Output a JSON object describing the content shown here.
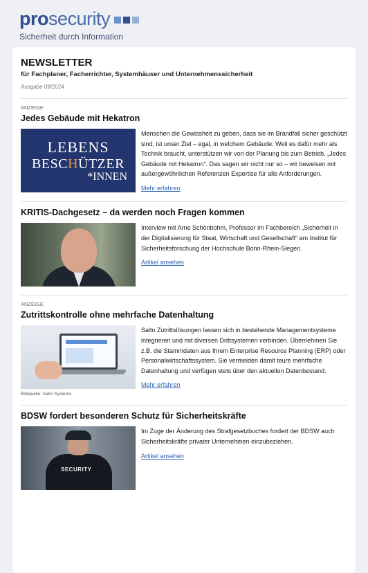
{
  "brand": {
    "logo_pro": "pro",
    "logo_security": "security",
    "tagline": "Sicherheit durch Information",
    "square_colors": [
      "#6e8fd0",
      "#2f4f8f",
      "#9ab0db"
    ]
  },
  "newsletter": {
    "title": "NEWSLETTER",
    "subtitle": "für Fachplaner, Facherrichter, Systemhäuser und Unternehmenssicherheit",
    "issue": "Ausgabe 09/2024"
  },
  "articles": [
    {
      "tag": "ANZEIGE",
      "title": "Jedes Gebäude mit Hekatron",
      "image_text": {
        "line1": "LEBENS",
        "line2a": "BESC",
        "line2b": "H",
        "line2c": "ÜTZER",
        "line3": "*INNEN"
      },
      "body": "Menschen die Gewissheit zu geben, dass sie im Brandfall sicher geschützt sind, ist unser Ziel – egal, in welchem Gebäude. Weil es dafür mehr als Technik braucht, unterstützen wir von der Planung bis zum Betrieb. „Jedes Gebäude mit Hekatron“. Das sagen wir nicht nur so – wir beweisen mit außergewöhnlichen Referenzen Expertise für alle Anforderungen.",
      "link": "Mehr erfahren"
    },
    {
      "tag": "",
      "title": "KRITIS-Dachgesetz – da werden noch Fragen kommen",
      "body": "Interview mit Arne Schönbohm, Professor im Fachbereich „Sicherheit in der Digitalisierung für Staat, Wirtschaft und Gesellschaft“ am Institut für Sicherheitsforschung der Hochschule Bonn-Rhein-Siegen.",
      "link": "Artikel ansehen"
    },
    {
      "tag": "ANZEIGE",
      "title": "Zutrittskontrolle ohne mehrfache Datenhaltung",
      "caption": "Bildquelle: Salto Systems",
      "body": "Salto Zutrittslösungen lassen sich in bestehende Managementsysteme integrieren und mit diversen Drittsystemen verbinden. Übernehmen Sie z.B. die Stammdaten aus Ihrem Enterprise Resource Planning (ERP) oder Personalwirtschaftssystem. Sie vermeiden damit teure mehrfache Datenhaltung und verfügen stets über den aktuellen Datenbestand.",
      "link": "Mehr erfahren"
    },
    {
      "tag": "",
      "title": "BDSW fordert besonderen Schutz für Sicherheitskräfte",
      "image_text": "SECURITY",
      "body": "Im Zuge der Änderung des Strafgesetzbuches fordert der BDSW auch Sicherheitskräfte privater Unternehmen einzubeziehen.",
      "link": "Artikel ansehen"
    }
  ]
}
